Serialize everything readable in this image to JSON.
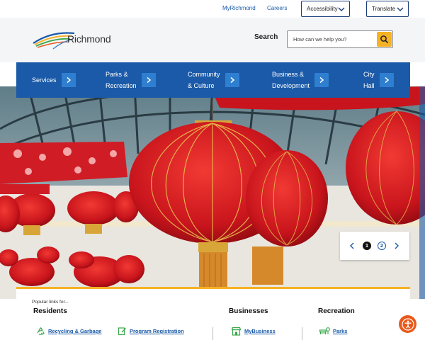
{
  "utility": {
    "myrichmond": "MyRichmond",
    "careers": "Careers",
    "accessibility": "Accessibility",
    "translate": "Translate"
  },
  "header": {
    "logo_text": "Richmond",
    "search_label": "Search",
    "search_placeholder": "How can we help you?"
  },
  "nav": {
    "items": [
      {
        "label": "Services"
      },
      {
        "label": "Parks &\nRecreation"
      },
      {
        "label": "Community\n& Culture"
      },
      {
        "label": "Business &\nDevelopment"
      },
      {
        "label": "City\nHall"
      }
    ]
  },
  "slider": {
    "slides": [
      "1",
      "2"
    ],
    "current": "1"
  },
  "popular": {
    "kicker": "Popular links for...",
    "residents": {
      "heading": "Residents",
      "links": [
        "Recycling & Garbage",
        "Program Registration"
      ]
    },
    "businesses": {
      "heading": "Businesses",
      "links": [
        "MyBusiness"
      ]
    },
    "recreation": {
      "heading": "Recreation",
      "links": [
        "Parks"
      ]
    }
  },
  "colors": {
    "nav_blue": "#1a5aa8",
    "accent_yellow": "#f5b225",
    "lantern_red": "#d81e24",
    "accessibility_orange": "#e8591a"
  },
  "icons": {
    "accessibility_widget": "accessibility-person-icon",
    "search": "search-icon"
  }
}
